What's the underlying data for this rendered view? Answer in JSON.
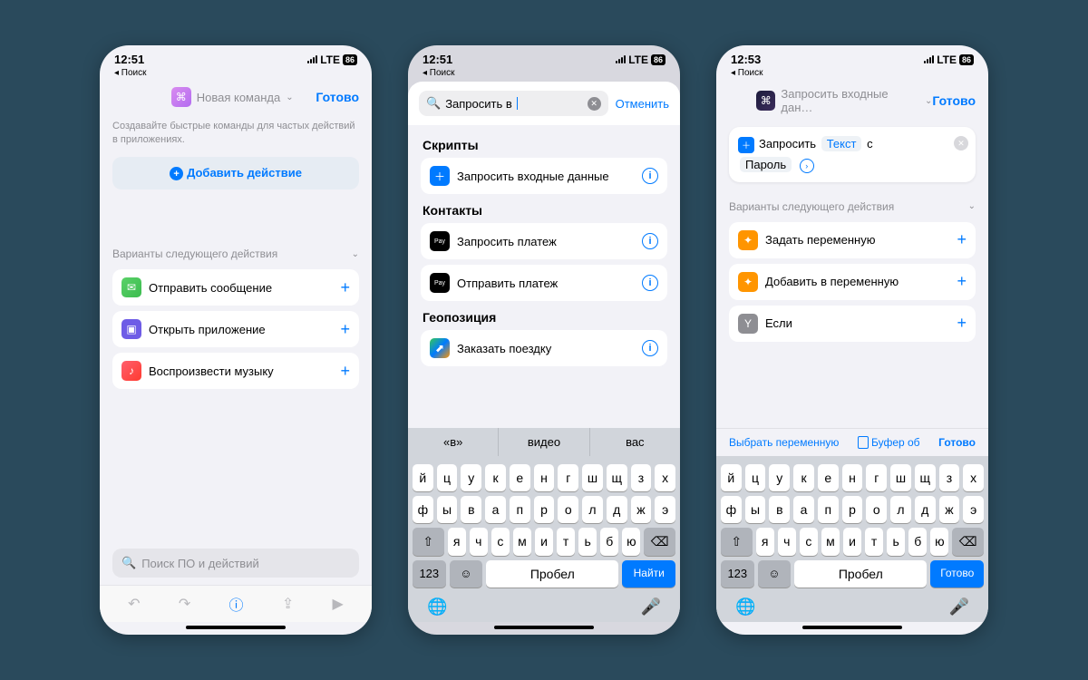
{
  "status": {
    "time1": "12:51",
    "time2": "12:51",
    "time3": "12:53",
    "network": "LTE",
    "battery": "86"
  },
  "back_label": "◂ Поиск",
  "done": "Готово",
  "phone1": {
    "title": "Новая команда",
    "desc": "Создавайте быстрые команды для частых действий в приложениях.",
    "add_action": "Добавить действие",
    "suggestions_header": "Варианты следующего действия",
    "suggestions": [
      {
        "label": "Отправить сообщение"
      },
      {
        "label": "Открыть приложение"
      },
      {
        "label": "Воспроизвести музыку"
      }
    ],
    "search_placeholder": "Поиск ПО и действий"
  },
  "phone2": {
    "search_value": "Запросить в",
    "cancel": "Отменить",
    "cats": {
      "scripts": "Скрипты",
      "contacts": "Контакты",
      "location": "Геопозиция"
    },
    "r_scripts": [
      {
        "label": "Запросить входные данные"
      }
    ],
    "r_contacts": [
      {
        "label": "Запросить платеж"
      },
      {
        "label": "Отправить платеж"
      }
    ],
    "r_location": [
      {
        "label": "Заказать поездку"
      }
    ],
    "kb_suggestions": [
      "«в»",
      "видео",
      "вас"
    ],
    "kb_action": "Найти"
  },
  "phone3": {
    "title": "Запросить входные дан…",
    "card": {
      "verb": "Запросить",
      "pill1": "Текст",
      "conn": "с",
      "pill2": "Пароль"
    },
    "suggestions_header": "Варианты следующего действия",
    "suggestions": [
      {
        "label": "Задать переменную",
        "color": "orange"
      },
      {
        "label": "Добавить в переменную",
        "color": "orange"
      },
      {
        "label": "Если",
        "color": "grey"
      }
    ],
    "varbar": {
      "select": "Выбрать переменную",
      "clipboard": "Буфер об",
      "done": "Готово"
    },
    "kb_action": "Готово"
  },
  "kb": {
    "row1": [
      "й",
      "ц",
      "у",
      "к",
      "е",
      "н",
      "г",
      "ш",
      "щ",
      "з",
      "х"
    ],
    "row2": [
      "ф",
      "ы",
      "в",
      "а",
      "п",
      "р",
      "о",
      "л",
      "д",
      "ж",
      "э"
    ],
    "row3": [
      "я",
      "ч",
      "с",
      "м",
      "и",
      "т",
      "ь",
      "б",
      "ю"
    ],
    "space": "Пробел",
    "num": "123"
  }
}
